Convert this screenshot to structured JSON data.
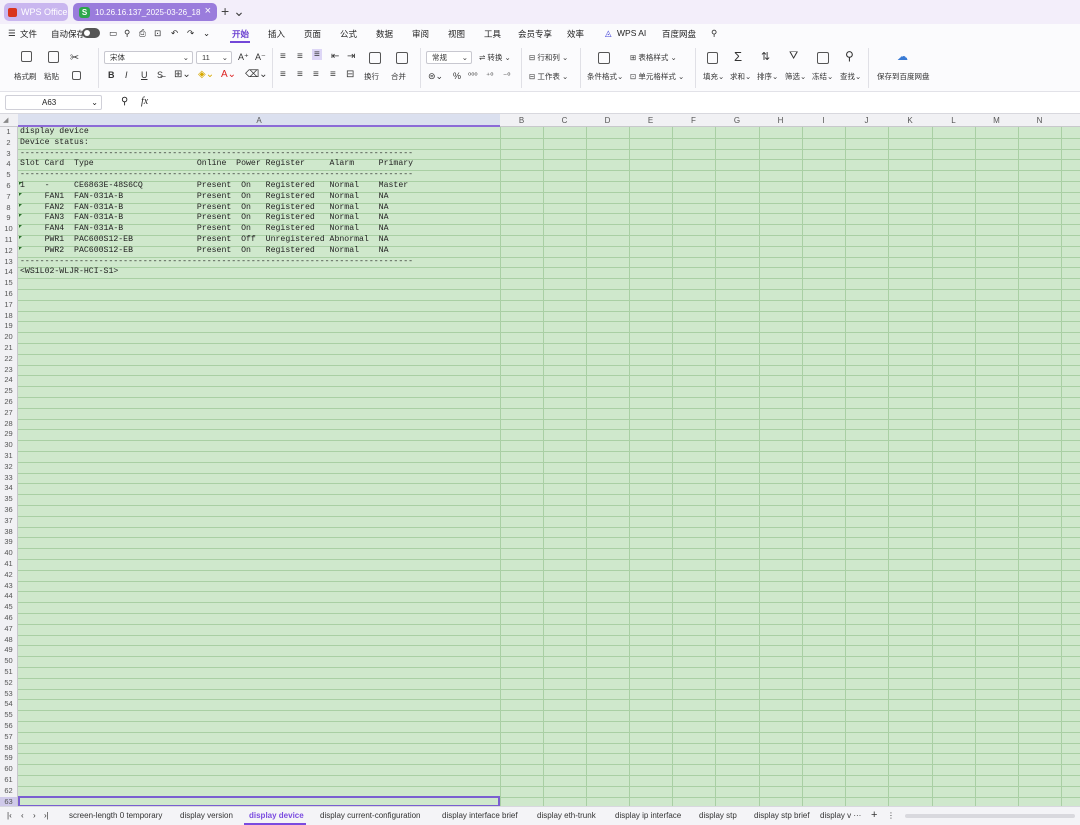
{
  "titlebar": {
    "app_tab": "WPS Office",
    "file_tab": "10.26.16.137_2025-03-26_18",
    "file_icon": "S",
    "add_icon": "plus-icon"
  },
  "menubar": {
    "file": "文件",
    "autosave": "自动保存",
    "tabs": [
      "开始",
      "插入",
      "页面",
      "公式",
      "数据",
      "审阅",
      "视图",
      "工具",
      "会员专享",
      "效率",
      "WPS AI",
      "百度网盘"
    ],
    "active": "开始"
  },
  "toolbar": {
    "format_painter": "格式刷",
    "paste": "粘贴",
    "font_name": "宋体",
    "font_size": "11",
    "bold": "B",
    "italic": "I",
    "underline": "U",
    "wrap": "换行",
    "merge": "合并",
    "number_format": "常规",
    "convert": "转换",
    "row_col": "行和列",
    "worksheet": "工作表",
    "conditional_format": "条件格式",
    "table_style": "表格样式",
    "cell_style": "单元格样式",
    "fill": "填充",
    "sum": "求和",
    "sort": "排序",
    "filter": "筛选",
    "freeze": "冻结",
    "find": "查找",
    "save_to_baidu": "保存到百度网盘"
  },
  "formula_bar": {
    "cell_ref": "A63",
    "fx": "fx",
    "value": ""
  },
  "columns": [
    "A",
    "B",
    "C",
    "D",
    "E",
    "F",
    "G",
    "H",
    "I",
    "J",
    "K",
    "L",
    "M",
    "N"
  ],
  "rows": {
    "count": 63
  },
  "cells": [
    "display device",
    "Device status:",
    "--------------------------------------------------------------------------------",
    "Slot Card  Type                     Online  Power Register     Alarm     Primary",
    "--------------------------------------------------------------------------------",
    "1    -     CE6863E-48S6CQ           Present  On   Registered   Normal    Master",
    "     FAN1  FAN-031A-B               Present  On   Registered   Normal    NA",
    "     FAN2  FAN-031A-B               Present  On   Registered   Normal    NA",
    "     FAN3  FAN-031A-B               Present  On   Registered   Normal    NA",
    "     FAN4  FAN-031A-B               Present  On   Registered   Normal    NA",
    "     PWR1  PAC600S12-EB             Present  Off  Unregistered Abnormal  NA",
    "     PWR2  PAC600S12-EB             Present  On   Registered   Normal    NA",
    "--------------------------------------------------------------------------------",
    "<WS1L02-WLJR-HCI-S1>"
  ],
  "sheet_tabs": [
    "screen-length 0 temporary",
    "display version",
    "display device",
    "display current-configuration",
    "display interface brief",
    "display eth-trunk",
    "display ip interface",
    "display stp",
    "display stp brief",
    "display v ···"
  ],
  "active_sheet": "display device",
  "colors": {
    "accent": "#7347d8",
    "sheet_bg": "#cfe8cc",
    "grid": "#a9cfa4"
  }
}
